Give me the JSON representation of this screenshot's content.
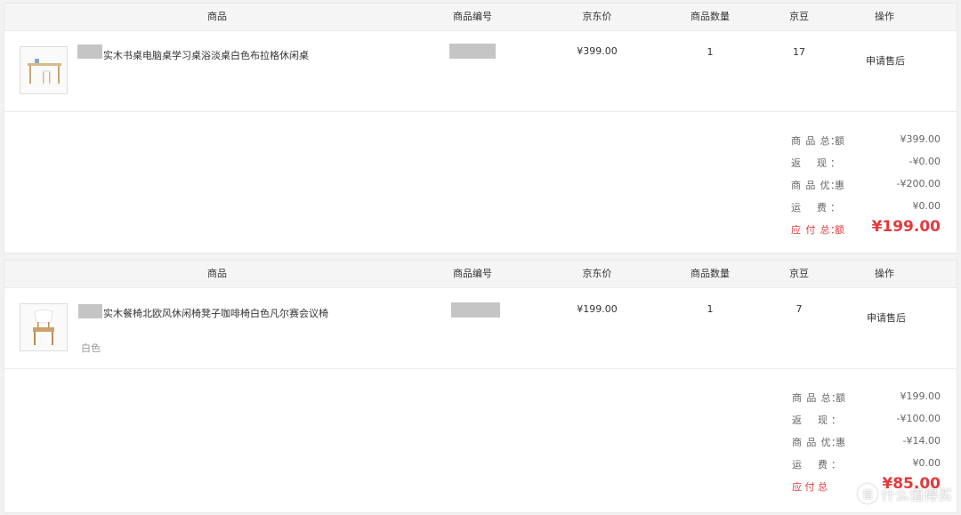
{
  "table_headers": {
    "product": "商品",
    "sku": "商品编号",
    "price": "京东价",
    "quantity": "商品数量",
    "beans": "京豆",
    "operation": "操作"
  },
  "orders": [
    {
      "product_name": "实木书桌电脑桌学习桌浴淡桌白色布拉格休闲桌",
      "variant": "",
      "price": "¥399.00",
      "quantity": "1",
      "beans": "17",
      "action": "申请售后",
      "thumbnail_icon": "desk-icon",
      "summary": {
        "total_label": "商品总额",
        "total_value": "¥399.00",
        "cashback_label": "返 现",
        "cashback_value": "-¥0.00",
        "discount_label": "商品优惠",
        "discount_value": "-¥200.00",
        "shipping_label": "运 费",
        "shipping_value": "¥0.00",
        "payable_label": "应付总额",
        "payable_value": "¥199.00"
      }
    },
    {
      "product_name": "实木餐椅北欧风休闲椅凳子咖啡椅白色凡尔赛会议椅",
      "variant": "白色",
      "price": "¥199.00",
      "quantity": "1",
      "beans": "7",
      "action": "申请售后",
      "thumbnail_icon": "chair-icon",
      "summary": {
        "total_label": "商品总额",
        "total_value": "¥199.00",
        "cashback_label": "返 现",
        "cashback_value": "-¥100.00",
        "discount_label": "商品优惠",
        "discount_value": "-¥14.00",
        "shipping_label": "运 费",
        "shipping_value": "¥0.00",
        "payable_label": "应付总",
        "payable_value": "¥85.00"
      }
    }
  ],
  "watermark": {
    "badge": "值",
    "text": "什么值得买"
  },
  "colors": {
    "accent_red": "#e4393c",
    "header_bg": "#f5f5f5",
    "mask_gray": "#c5c5c5"
  }
}
